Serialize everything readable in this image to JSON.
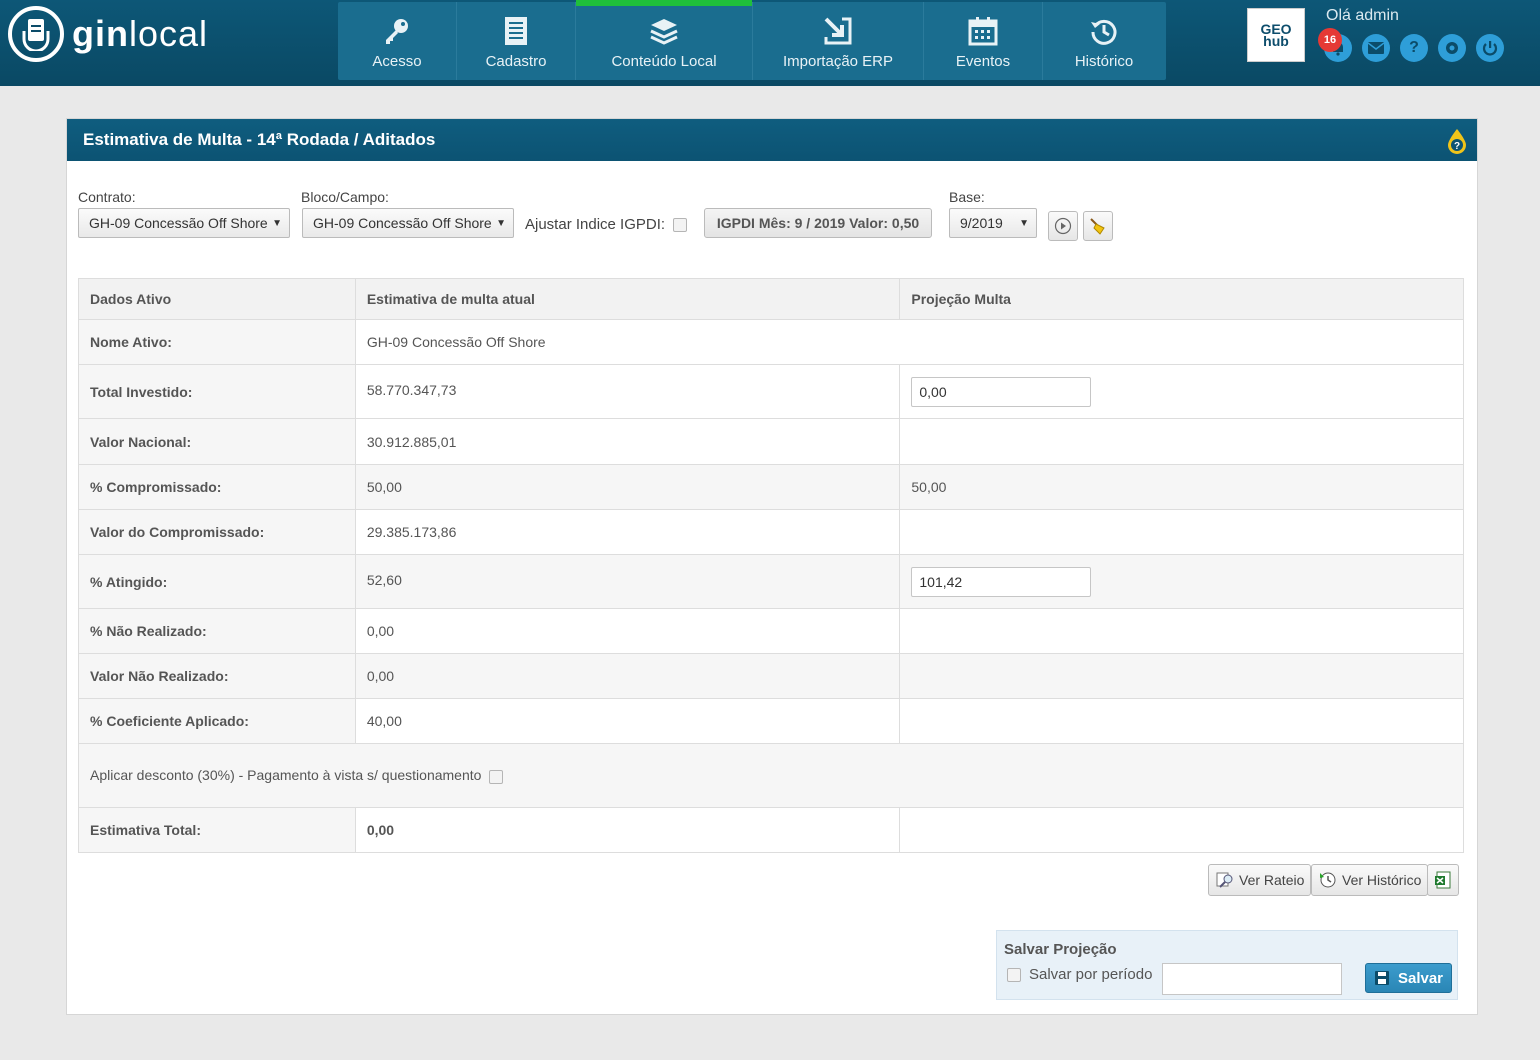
{
  "app": {
    "logo_bold": "gin",
    "logo_light": "local"
  },
  "nav": [
    {
      "label": "Acesso",
      "icon": "key-icon"
    },
    {
      "label": "Cadastro",
      "icon": "document-icon"
    },
    {
      "label": "Conteúdo Local",
      "icon": "layers-icon",
      "active": true
    },
    {
      "label": "Importação ERP",
      "icon": "import-icon"
    },
    {
      "label": "Eventos",
      "icon": "calendar-icon"
    },
    {
      "label": "Histórico",
      "icon": "history-icon"
    }
  ],
  "header": {
    "geohub": "GEO hub",
    "greeting": "Olá admin",
    "notifications": "16",
    "icons": [
      "bell-icon",
      "mail-icon",
      "help-icon",
      "settings-icon",
      "power-icon"
    ]
  },
  "panel": {
    "title": "Estimativa de Multa - 14ª Rodada / Aditados"
  },
  "filters": {
    "contrato_label": "Contrato:",
    "contrato_value": "GH-09 Concessão Off Shore",
    "bloco_label": "Bloco/Campo:",
    "bloco_value": "GH-09 Concessão Off Shore",
    "ajustar_label": "Ajustar Indice IGPDI:",
    "igpdi_text": "IGPDI Mês: 9 / 2019 Valor: 0,50",
    "base_label": "Base:",
    "base_value": "9/2019"
  },
  "table": {
    "headers": [
      "Dados Ativo",
      "Estimativa de multa atual",
      "Projeção Multa"
    ],
    "rows": [
      {
        "label": "Nome Ativo:",
        "current": "GH-09 Concessão Off Shore",
        "projection": ""
      },
      {
        "label": "Total Investido:",
        "current": "58.770.347,73",
        "projection_input": "0,00"
      },
      {
        "label": "Valor Nacional:",
        "current": "30.912.885,01",
        "projection": ""
      },
      {
        "label": "% Compromissado:",
        "current": "50,00",
        "projection": "50,00"
      },
      {
        "label": "Valor do Compromissado:",
        "current": "29.385.173,86",
        "projection": ""
      },
      {
        "label": "% Atingido:",
        "current": "52,60",
        "projection_input": "101,42"
      },
      {
        "label": "% Não Realizado:",
        "current": "0,00",
        "projection": ""
      },
      {
        "label": "Valor Não Realizado:",
        "current": "0,00",
        "projection": ""
      },
      {
        "label": "% Coeficiente Aplicado:",
        "current": "40,00",
        "projection": ""
      }
    ],
    "discount_label": "Aplicar desconto (30%) - Pagamento à vista s/ questionamento",
    "total_label": "Estimativa Total:",
    "total_value": "0,00"
  },
  "actions": {
    "ver_rateio": "Ver Rateio",
    "ver_historico": "Ver Histórico"
  },
  "save": {
    "title": "Salvar Projeção",
    "periodo_label": "Salvar por período",
    "button": "Salvar"
  }
}
